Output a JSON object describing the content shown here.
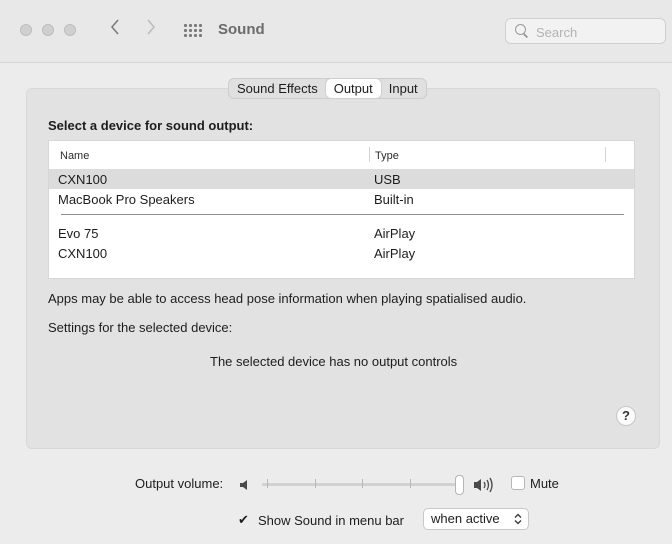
{
  "window": {
    "title": "Sound",
    "search_placeholder": "Search"
  },
  "tabs": [
    {
      "label": "Sound Effects",
      "active": false
    },
    {
      "label": "Output",
      "active": true
    },
    {
      "label": "Input",
      "active": false
    }
  ],
  "output": {
    "heading": "Select a device for sound output:",
    "columns": {
      "name": "Name",
      "type": "Type"
    },
    "devices": [
      {
        "name": "CXN100",
        "type": "USB",
        "selected": true
      },
      {
        "name": "MacBook Pro Speakers",
        "type": "Built-in",
        "selected": false
      },
      {
        "name": "Evo 75",
        "type": "AirPlay",
        "selected": false
      },
      {
        "name": "CXN100",
        "type": "AirPlay",
        "selected": false
      }
    ],
    "spatial_note": "Apps may be able to access head pose information when playing spatialised audio.",
    "settings_label": "Settings for the selected device:",
    "no_controls": "The selected device has no output controls",
    "help": "?"
  },
  "bottom": {
    "output_volume_label": "Output volume:",
    "volume_level": 1.0,
    "mute_label": "Mute",
    "mute_checked": false,
    "show_in_menu_bar_label": "Show Sound in menu bar",
    "show_in_menu_bar_checked": true,
    "menu_bar_option": "when active"
  },
  "icons": {
    "close": "traffic-light-icon",
    "back": "chevron-left-icon",
    "forward": "chevron-right-icon",
    "grid": "grid-icon",
    "search": "search-icon",
    "speaker_low": "speaker-low-icon",
    "speaker_high": "speaker-high-icon",
    "popup": "updown-chevron-icon"
  }
}
